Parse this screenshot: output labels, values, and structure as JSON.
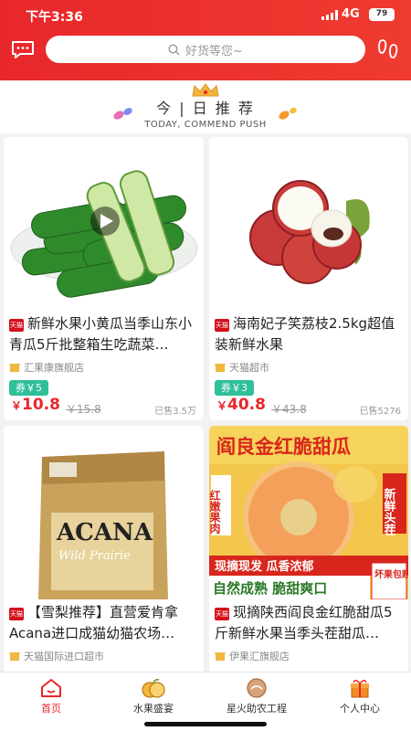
{
  "status_bar": {
    "time": "下午3:36",
    "network": "4G",
    "battery": "79"
  },
  "search": {
    "placeholder": "好货等您~"
  },
  "today": {
    "title": "今 | 日 推 荐",
    "subtitle": "TODAY, COMMEND PUSH"
  },
  "products": [
    {
      "title": "新鲜水果小黄瓜当季山东小青瓜5斤批整箱生吃蔬菜…",
      "shop": "汇果康旗舰店",
      "coupon": "券￥5",
      "price_symbol": "￥",
      "price": "10.8",
      "old_price": "￥15.8",
      "sold": "已售3.5万",
      "badge": "天猫"
    },
    {
      "title": "海南妃子笑荔枝2.5kg超值装新鲜水果",
      "shop": "天猫超市",
      "coupon": "券￥3",
      "price_symbol": "￥",
      "price": "40.8",
      "old_price": "￥43.8",
      "sold": "已售5276",
      "badge": "天猫"
    },
    {
      "title": "【雪梨推荐】直营爱肯拿Acana进口成猫幼猫农场…",
      "shop": "天猫国际进口超市",
      "badge": "天猫",
      "image_text": {
        "brand": "ACANA",
        "line": "Wild Prairie"
      }
    },
    {
      "title": "现摘陕西阎良金红脆甜瓜5斤新鲜水果当季头茬甜瓜…",
      "shop": "伊果汇旗舰店",
      "badge": "天猫",
      "image_text": {
        "top": "阎良金红脆甜瓜",
        "left": "红嫩果肉",
        "right": "新鲜头茬",
        "band": "现摘现发 瓜香浓郁",
        "bottom": "自然成熟 脆甜爽口",
        "stamp": "坏果包赔"
      }
    }
  ],
  "tabs": [
    {
      "label": "首页",
      "icon": "home-icon",
      "active": true
    },
    {
      "label": "水果盛宴",
      "icon": "fruit-icon",
      "active": false
    },
    {
      "label": "星火助农工程",
      "icon": "farm-icon",
      "active": false
    },
    {
      "label": "个人中心",
      "icon": "gift-icon",
      "active": false
    }
  ],
  "colors": {
    "brand_red": "#e8272b",
    "coupon_green": "#2fbf9a",
    "price_red": "#e8272b"
  }
}
